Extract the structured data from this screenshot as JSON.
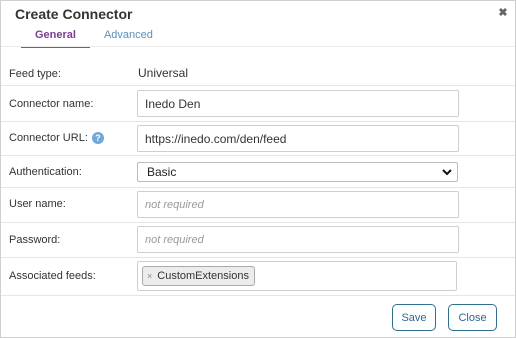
{
  "dialog": {
    "title": "Create Connector",
    "close_glyph": "✖"
  },
  "tabs": [
    {
      "label": "General",
      "active": true
    },
    {
      "label": "Advanced",
      "active": false
    }
  ],
  "form": {
    "feed_type": {
      "label": "Feed type:",
      "value": "Universal"
    },
    "connector_name": {
      "label": "Connector name:",
      "value": "Inedo Den"
    },
    "connector_url": {
      "label": "Connector URL:",
      "value": "https://inedo.com/den/feed",
      "help_icon": "?"
    },
    "authentication": {
      "label": "Authentication:",
      "selected": "Basic"
    },
    "user_name": {
      "label": "User name:",
      "placeholder": "not required"
    },
    "password": {
      "label": "Password:",
      "placeholder": "not required"
    },
    "associated_feeds": {
      "label": "Associated feeds:",
      "tags": [
        {
          "label": "CustomExtensions",
          "remove_glyph": "×"
        }
      ]
    }
  },
  "buttons": {
    "save_label": "Save",
    "close_label": "Close"
  },
  "colors": {
    "active_tab": "#7b3e94",
    "tab_link": "#5b8fb8",
    "button_border": "#2f6f8f",
    "help_icon": "#6fa8d6"
  }
}
